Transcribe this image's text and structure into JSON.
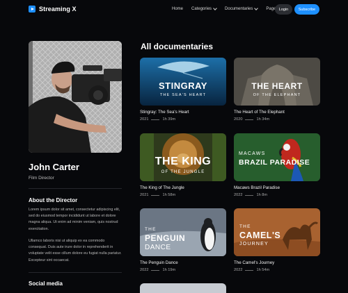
{
  "header": {
    "brand": "Streaming X",
    "nav": [
      "Home",
      "Categories",
      "Documentaries",
      "Pages"
    ],
    "login_label": "Login",
    "subscribe_label": "Subscribe"
  },
  "profile": {
    "name": "John Carter",
    "role": "Film Director",
    "about_heading": "About the Director",
    "about_p1": "Lorem ipsum dolor sit amet, consectetur adipiscing elit, sed do eiusmod tempor incididunt ut labore et dolore magna aliqua. Ut enim ad minim veniam, quis nostrud exercitation.",
    "about_p2": "Ullamco laboris nisi ut aliquip ex ea commodo consequat. Duis aute irure dolor in reprehenderit in voluptate velit esse cillum dolore eu fugiat nulla pariatur. Excepteur sint occaecat.",
    "social_heading": "Social media"
  },
  "section_title": "All documentaries",
  "cards": [
    {
      "thumb_l1": "STINGRAY",
      "thumb_l2": "THE SEA'S HEART",
      "title": "Stingray: The Sea's Heart",
      "year": "2021",
      "duration": "1h 39m"
    },
    {
      "thumb_l1": "THE HEART",
      "thumb_l2": "OF THE ELEPHANT",
      "title": "The Heart of The Elephant",
      "year": "2020",
      "duration": "1h 34m"
    },
    {
      "thumb_l1": "THE KING",
      "thumb_l2": "OF THE JUNGLE",
      "title": "The King of The Jungle",
      "year": "2021",
      "duration": "1h 58m"
    },
    {
      "thumb_l1": "MACAWS",
      "thumb_l2": "BRAZIL PARADISE",
      "title": "Macaws Brazil Paradise",
      "year": "2022",
      "duration": "1h 8m"
    },
    {
      "thumb_l1": "THE",
      "thumb_l2": "PENGUIN",
      "thumb_l3": "DANCE",
      "title": "The Penguin Dance",
      "year": "2022",
      "duration": "1h 19m"
    },
    {
      "thumb_l1": "THE",
      "thumb_l2": "CAMEL'S",
      "thumb_l3": "JOURNEY",
      "title": "The Camel's Journey",
      "year": "2022",
      "duration": "1h 54m"
    }
  ]
}
